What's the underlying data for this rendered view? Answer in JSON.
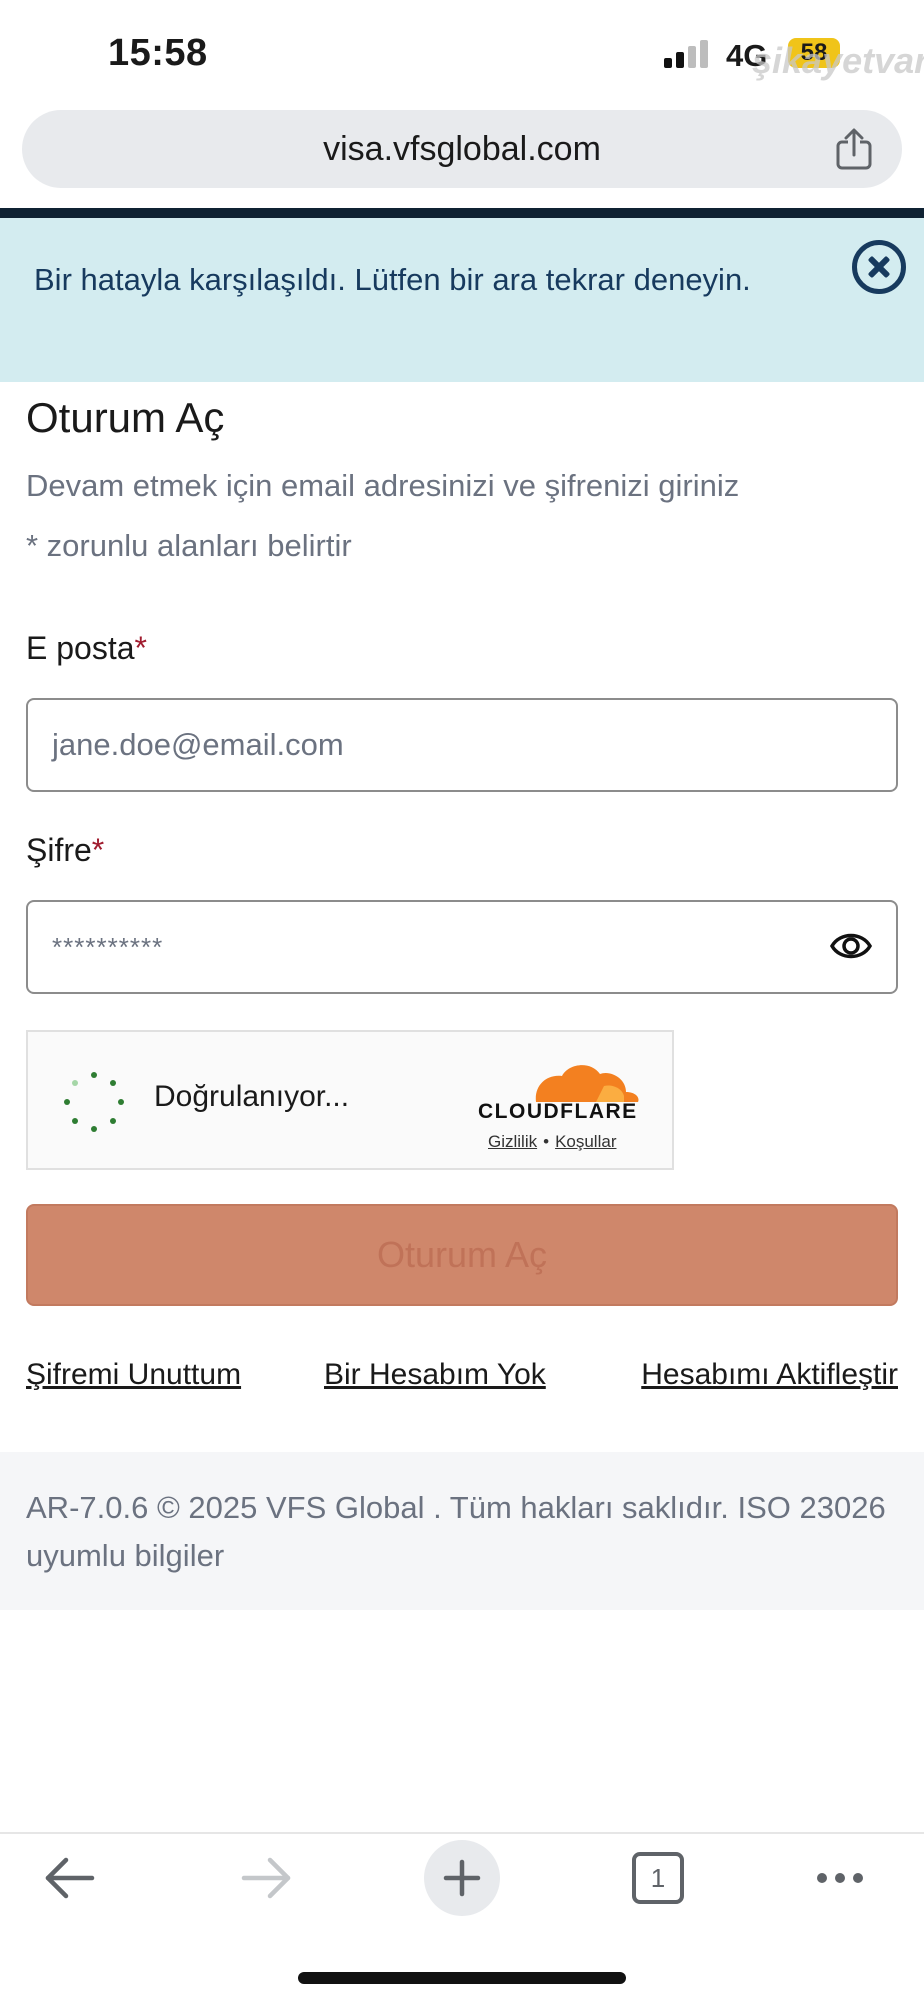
{
  "status_bar": {
    "time": "15:58",
    "network": "4G",
    "battery": "58",
    "watermark": "şikayetvar"
  },
  "browser": {
    "url": "visa.vfsglobal.com",
    "tab_count": "1"
  },
  "alert": {
    "message": "Bir hatayla karşılaşıldı. Lütfen bir ara tekrar deneyin."
  },
  "login": {
    "title": "Oturum Aç",
    "subtitle": "Devam etmek için email adresinizi ve şifrenizi giriniz",
    "required_note": "* zorunlu alanları belirtir",
    "email_label": "E posta",
    "email_placeholder": "jane.doe@email.com",
    "password_label": "Şifre",
    "password_value": "**********",
    "required_mark": "*",
    "submit_label": "Oturum Aç"
  },
  "captcha": {
    "status": "Doğrulanıyor...",
    "brand": "CLOUDFLARE",
    "privacy": "Gizlilik",
    "separator": "•",
    "terms": "Koşullar"
  },
  "links": {
    "forgot_password": "Şifremi Unuttum",
    "no_account": "Bir Hesabım Yok",
    "activate_account": "Hesabımı Aktifleştir"
  },
  "footer": {
    "text": "AR-7.0.6 © 2025 VFS Global . Tüm hakları saklıdır. ISO 23026 uyumlu bilgiler"
  },
  "colors": {
    "alert_bg": "#d3ecf0",
    "alert_text": "#173a5e",
    "submit_bg": "#cf876b",
    "required": "#a01b2e",
    "cloudflare_orange": "#f38020"
  }
}
